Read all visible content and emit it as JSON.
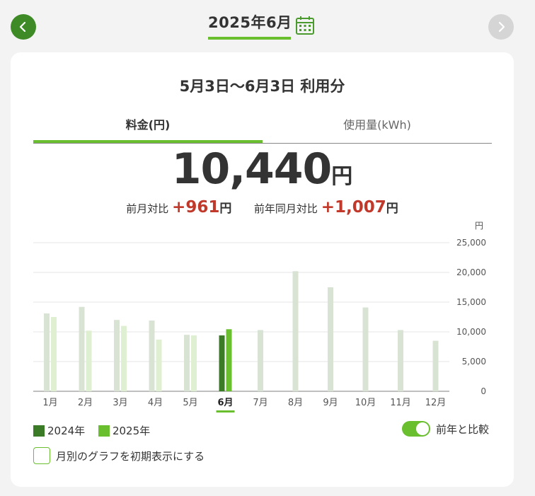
{
  "header": {
    "month_title": "2025年6月",
    "prev_icon": "chevron-left-icon",
    "next_icon": "chevron-right-icon",
    "calendar_icon": "calendar-icon"
  },
  "card": {
    "period": "5月3日〜6月3日 利用分",
    "tabs": [
      {
        "label": "料金(円)",
        "active": true
      },
      {
        "label": "使用量(kWh)",
        "active": false
      }
    ],
    "amount": "10,440",
    "amount_unit": "円",
    "compare_prev_month_label": "前月対比",
    "compare_prev_month_value": "+961",
    "compare_prev_month_unit": "円",
    "compare_prev_year_label": "前年同月対比",
    "compare_prev_year_value": "+1,007",
    "compare_prev_year_unit": "円"
  },
  "legend": {
    "items": [
      {
        "label": "2024年",
        "color": "#3b7a27"
      },
      {
        "label": "2025年",
        "color": "#6abf2e"
      }
    ]
  },
  "toggle": {
    "label": "前年と比較",
    "on": true
  },
  "checkbox": {
    "label": "月別のグラフを初期表示にする",
    "checked": false
  },
  "colors": {
    "accent": "#6abf2e",
    "dark_green": "#3b7a27",
    "prev_year_faded": "#d8e3d4",
    "curr_year_faded": "#dff0d2",
    "diff_red": "#c0392b"
  },
  "chart_data": {
    "type": "bar",
    "unit_label": "円",
    "categories": [
      "1月",
      "2月",
      "3月",
      "4月",
      "5月",
      "6月",
      "7月",
      "8月",
      "9月",
      "10月",
      "11月",
      "12月"
    ],
    "selected_category": "6月",
    "series": [
      {
        "name": "2024年",
        "values": [
          13100,
          14200,
          12000,
          11900,
          9500,
          9400,
          10300,
          20200,
          17500,
          14100,
          10300,
          8500
        ]
      },
      {
        "name": "2025年",
        "values": [
          12500,
          10200,
          11000,
          8700,
          9400,
          10440,
          null,
          null,
          null,
          null,
          null,
          null
        ]
      }
    ],
    "ylim": [
      0,
      25000
    ],
    "yticks": [
      "0",
      "5,000",
      "10,000",
      "15,000",
      "20,000",
      "25,000"
    ],
    "ytick_values": [
      0,
      5000,
      10000,
      15000,
      20000,
      25000
    ],
    "grid": true
  }
}
